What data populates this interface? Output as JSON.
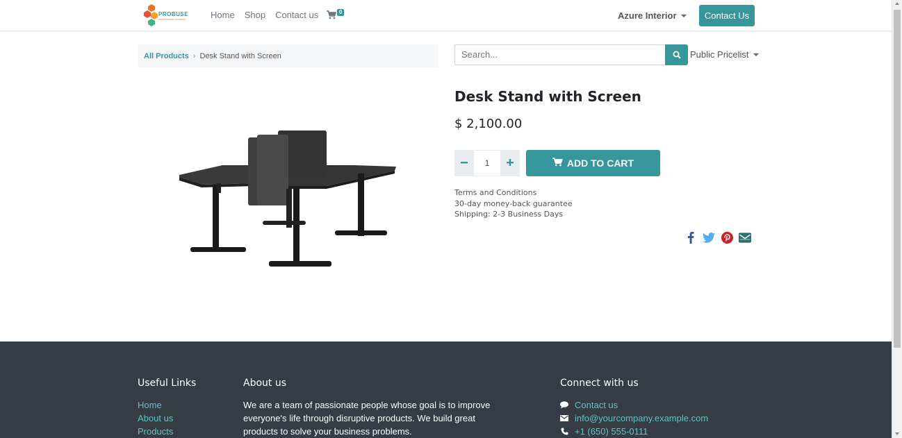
{
  "header": {
    "logo_text": "PROBUSE",
    "nav": [
      "Home",
      "Shop",
      "Contact us"
    ],
    "cart_count": "0",
    "company": "Azure Interior",
    "contact_button": "Contact Us"
  },
  "breadcrumb": {
    "root": "All Products",
    "current": "Desk Stand with Screen"
  },
  "search": {
    "placeholder": "Search..."
  },
  "pricelist": "Public Pricelist",
  "product": {
    "name": "Desk Stand with Screen",
    "price": "$ 2,100.00",
    "quantity": "1",
    "add_to_cart": "ADD TO CART",
    "terms": [
      "Terms and Conditions",
      "30-day money-back guarantee",
      "Shipping: 2-3 Business Days"
    ]
  },
  "social": [
    "facebook-icon",
    "twitter-icon",
    "pinterest-icon",
    "envelope-icon"
  ],
  "footer": {
    "useful_links_title": "Useful Links",
    "useful_links": [
      "Home",
      "About us",
      "Products"
    ],
    "about_title": "About us",
    "about_text": "We are a team of passionate people whose goal is to improve everyone's life through disruptive products. We build great products to solve your business problems.",
    "connect_title": "Connect with us",
    "connect": {
      "contact": "Contact us",
      "email": "info@yourcompany.example.com",
      "phone": "+1 (650) 555-0111"
    }
  },
  "colors": {
    "accent": "#35979c",
    "footer_bg": "#353c43",
    "footer_link": "#5fc3c8"
  }
}
